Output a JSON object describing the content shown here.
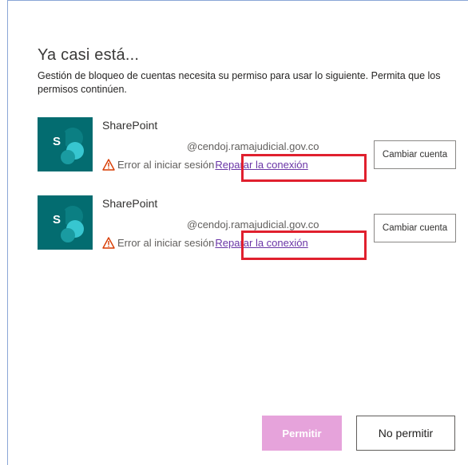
{
  "dialog": {
    "title": "Ya casi está...",
    "description": "Gestión de bloqueo de cuentas necesita su permiso para usar lo siguiente. Permita que los permisos continúen."
  },
  "accounts": [
    {
      "app_name": "SharePoint",
      "email": "@cendoj.ramajudicial.gov.co",
      "status": "Error al iniciar sesión",
      "repair_link": "Reparar la conexión",
      "switch_label": "Cambiar cuenta",
      "icon": "sharepoint-icon"
    },
    {
      "app_name": "SharePoint",
      "email": "@cendoj.ramajudicial.gov.co",
      "status": "Error al iniciar sesión",
      "repair_link": "Reparar la conexión",
      "switch_label": "Cambiar cuenta",
      "icon": "sharepoint-icon"
    }
  ],
  "buttons": {
    "allow": "Permitir",
    "deny": "No permitir"
  },
  "colors": {
    "sharepoint_tile": "#036c70",
    "link": "#6a35a6",
    "highlight_box": "#e0202e",
    "allow_disabled": "#e6a3db",
    "warning": "#d83b01"
  }
}
